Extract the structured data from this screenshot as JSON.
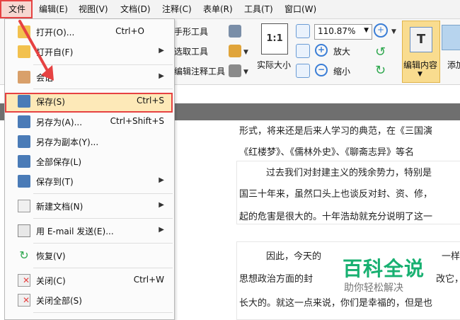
{
  "menubar": {
    "items": [
      "文件",
      "编辑(E)",
      "视图(V)",
      "文档(D)",
      "注释(C)",
      "表单(R)",
      "工具(T)",
      "窗口(W)"
    ]
  },
  "ribbon": {
    "text_tools": [
      "手形工具",
      "选取工具",
      "编辑注释工具"
    ],
    "actual_size": "实际大小",
    "zoom_value": "110.87%",
    "zoom_in": "放大",
    "zoom_out": "缩小",
    "edit_content": "编辑内容",
    "add_partial": "添加"
  },
  "file_menu": {
    "open": {
      "label": "打开(O)...",
      "shortcut": "Ctrl+O"
    },
    "open_from": {
      "label": "打开自(F)"
    },
    "session": {
      "label": "会话"
    },
    "save": {
      "label": "保存(S)",
      "shortcut": "Ctrl+S"
    },
    "save_as": {
      "label": "另存为(A)...",
      "shortcut": "Ctrl+Shift+S"
    },
    "save_copy": {
      "label": "另存为副本(Y)..."
    },
    "save_all": {
      "label": "全部保存(L)"
    },
    "save_to": {
      "label": "保存到(T)"
    },
    "new_doc": {
      "label": "新建文档(N)"
    },
    "email": {
      "label": "用 E-mail 发送(E)..."
    },
    "revert": {
      "label": "恢复(V)"
    },
    "close": {
      "label": "关闭(C)",
      "shortcut": "Ctrl+W"
    },
    "close_all": {
      "label": "关闭全部(S)"
    }
  },
  "document": {
    "lines": [
      "形式，将来还是后来人学习的典范，在《三国演",
      "《红楼梦》、《儒林外史》、《聊斋志异》等名",
      "过去我们对封建主义的残余势力，特别是",
      "国三十年来，虽然口头上也谈反对封、资、修，",
      "起的危害是很大的。十年浩劫就充分说明了这一",
      "因此，今天的",
      "一样",
      "思想政治方面的封",
      "改它，",
      "长大的。就这一点来说，你们是幸福的，但是也"
    ]
  },
  "watermark": {
    "title": "百科全说",
    "subtitle": "助你轻松解决"
  },
  "colors": {
    "highlight_red": "#e64242",
    "menu_hover": "#fde9b8",
    "watermark_green": "#18b071"
  }
}
